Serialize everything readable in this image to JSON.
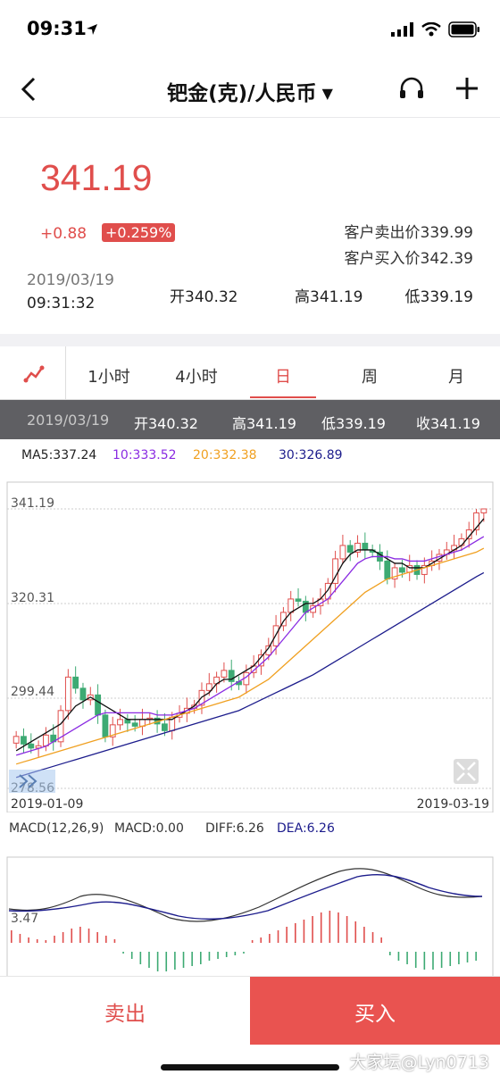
{
  "status": {
    "time": "09:31"
  },
  "nav": {
    "title": "钯金(克)/人民币",
    "caret": "▼"
  },
  "quote": {
    "price": "341.19",
    "change": "+0.88",
    "change_pct": "+0.259%",
    "ask_label": "客户卖出价339.99",
    "bid_label": "客户买入价342.39",
    "date": "2019/03/19",
    "time": "09:31:32",
    "open": "开340.32",
    "high": "高341.19",
    "low": "低339.19"
  },
  "tabs": [
    {
      "label": "1小时"
    },
    {
      "label": "4小时"
    },
    {
      "label": "日"
    },
    {
      "label": "周"
    },
    {
      "label": "月"
    }
  ],
  "ohlc": {
    "date": "2019/03/19",
    "open": "开340.32",
    "high": "高341.19",
    "low": "低339.19",
    "close": "收341.19"
  },
  "ma": {
    "ma5": "MA5:337.24",
    "ma10": "10:333.52",
    "ma20": "20:332.38",
    "ma30": "30:326.89"
  },
  "macd": {
    "params": "MACD(12,26,9)",
    "macd": "MACD:0.00",
    "diff": "DIFF:6.26",
    "dea": "DEA:6.26",
    "axis_label": "3.47"
  },
  "chart_data": {
    "type": "candlestick",
    "y_ticks": [
      "341.19",
      "320.31",
      "299.44",
      "278.56"
    ],
    "ylim": [
      278.56,
      341.19
    ],
    "x_start": "2019-01-09",
    "x_end": "2019-03-19",
    "close": [
      290.2,
      288.5,
      287.6,
      288.1,
      290.5,
      289.0,
      296.0,
      303.5,
      301.0,
      298.4,
      299.5,
      295.0,
      290.1,
      292.8,
      294.0,
      293.2,
      292.5,
      294.0,
      294.3,
      293.0,
      291.5,
      294.5,
      295.4,
      296.5,
      297.2,
      300.5,
      302.0,
      303.5,
      305.0,
      302.5,
      301.8,
      304.5,
      306.0,
      308.5,
      310.5,
      315.0,
      318.0,
      321.0,
      320.5,
      318.0,
      319.5,
      321.0,
      324.5,
      330.0,
      333.0,
      331.5,
      333.5,
      332.0,
      331.5,
      329.5,
      325.5,
      328.0,
      327.0,
      328.5,
      326.5,
      328.5,
      329.5,
      331.0,
      332.0,
      333.0,
      334.5,
      336.5,
      340.3,
      341.19
    ],
    "ma": {
      "MA5": [
        287,
        288,
        289,
        290,
        291,
        292,
        293,
        295,
        297,
        298,
        299,
        298,
        297,
        296,
        295,
        294,
        294,
        294,
        294,
        294,
        294,
        294,
        295,
        296,
        297,
        299,
        300,
        302,
        303,
        303,
        304,
        305,
        306,
        308,
        310,
        313,
        316,
        318,
        319,
        320,
        320,
        321,
        323,
        326,
        329,
        331,
        332,
        332,
        332,
        331,
        330,
        329,
        329,
        328,
        328,
        328,
        329,
        330,
        331,
        332,
        333,
        335,
        337,
        339
      ],
      "MA10": [
        286,
        286.5,
        287,
        287.5,
        288,
        289,
        290,
        291,
        292,
        293,
        294,
        295,
        295.5,
        295.5,
        295.5,
        295.5,
        295.5,
        295.5,
        295.5,
        295,
        295,
        295,
        295.5,
        296,
        296.5,
        297.5,
        298.5,
        299.5,
        300.5,
        301.5,
        302.5,
        303.5,
        305,
        306.5,
        308,
        310,
        312,
        314,
        316,
        318,
        319,
        320,
        321,
        323,
        325,
        327,
        329,
        330,
        330.5,
        330.5,
        330.5,
        330,
        330,
        329.5,
        329.5,
        329.5,
        330,
        330.5,
        331,
        331.5,
        332,
        333,
        334,
        335
      ],
      "MA20": [
        284,
        284.5,
        285,
        285.5,
        286,
        286.5,
        287,
        287.5,
        288,
        288.5,
        289,
        289.5,
        290,
        290.5,
        291,
        291.5,
        292,
        292.5,
        293,
        293.5,
        294,
        294.5,
        295,
        295.5,
        296,
        296.5,
        297,
        297.5,
        298,
        298.5,
        299,
        300,
        301,
        302,
        303,
        304.5,
        306,
        307.5,
        309,
        310.5,
        312,
        313.5,
        315,
        316.5,
        318,
        319.5,
        321,
        322.5,
        323.5,
        324.5,
        325.5,
        326,
        326.5,
        327,
        327.5,
        328,
        328.5,
        329,
        329.5,
        330,
        330.5,
        331,
        331.5,
        332.38
      ],
      "MA30": [
        281,
        281.5,
        282,
        282.5,
        283,
        283.5,
        284,
        284.5,
        285,
        285.5,
        286,
        286.5,
        287,
        287.5,
        288,
        288.5,
        289,
        289.5,
        290,
        290.5,
        291,
        291.5,
        292,
        292.5,
        293,
        293.5,
        294,
        294.5,
        295,
        295.5,
        296,
        296.8,
        297.6,
        298.4,
        299.2,
        300,
        300.8,
        301.6,
        302.4,
        303.2,
        304,
        305,
        306,
        307,
        308,
        309,
        310,
        311,
        312,
        313,
        314,
        315,
        316,
        317,
        318,
        319,
        320,
        321,
        322,
        323,
        324,
        325,
        326,
        326.89
      ]
    }
  },
  "actions": {
    "sell": "卖出",
    "buy": "买入"
  },
  "watermark": "大家坛@Lyn0713",
  "colors": {
    "up": "#e04e4c",
    "down": "#3daa73",
    "ma5": "#111111",
    "ma10": "#8a2be2",
    "ma20": "#f0a020",
    "ma30": "#1c1c8c"
  }
}
